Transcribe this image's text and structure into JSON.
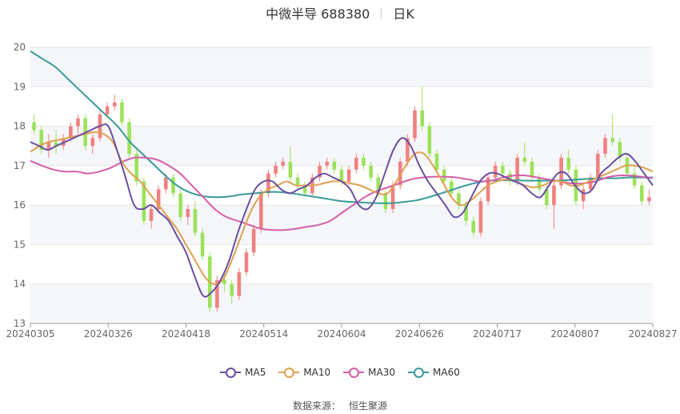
{
  "header": {
    "title": "中微半导 688380",
    "period": "日K"
  },
  "source": {
    "label": "数据来源：",
    "name": "恒生聚源"
  },
  "colors": {
    "up": "#f08080",
    "down": "#9be25a",
    "MA5": "#6a4fa0",
    "MA10": "#e0a050",
    "MA30": "#d55ea8",
    "MA60": "#3a9a98"
  },
  "chart_data": {
    "type": "candlestick",
    "title": "中微半导 688380",
    "ylim": [
      13,
      20
    ],
    "yticks": [
      13,
      14,
      15,
      16,
      17,
      18,
      19,
      20
    ],
    "xtick_labels": [
      "20240305",
      "20240326",
      "20240418",
      "20240514",
      "20240604",
      "20240626",
      "20240717",
      "20240807",
      "20240827"
    ],
    "grid": true,
    "legend_position": "bottom",
    "series_names": [
      "MA5",
      "MA10",
      "MA30",
      "MA60"
    ],
    "ohlc": [
      [
        18.1,
        18.3,
        17.8,
        17.9
      ],
      [
        17.9,
        18.0,
        17.3,
        17.4
      ],
      [
        17.4,
        17.8,
        17.2,
        17.6
      ],
      [
        17.6,
        17.9,
        17.3,
        17.5
      ],
      [
        17.5,
        17.8,
        17.4,
        17.7
      ],
      [
        17.7,
        18.1,
        17.6,
        18.0
      ],
      [
        18.0,
        18.3,
        17.8,
        18.2
      ],
      [
        18.2,
        18.3,
        17.4,
        17.5
      ],
      [
        17.5,
        17.8,
        17.3,
        17.7
      ],
      [
        17.7,
        18.4,
        17.6,
        18.3
      ],
      [
        18.3,
        18.6,
        18.2,
        18.5
      ],
      [
        18.5,
        18.8,
        18.4,
        18.6
      ],
      [
        18.6,
        18.7,
        18.0,
        18.1
      ],
      [
        18.1,
        18.2,
        17.2,
        17.3
      ],
      [
        17.3,
        17.4,
        16.5,
        16.6
      ],
      [
        16.6,
        16.7,
        15.5,
        15.6
      ],
      [
        15.6,
        16.0,
        15.4,
        15.9
      ],
      [
        15.9,
        16.5,
        15.8,
        16.4
      ],
      [
        16.4,
        16.8,
        16.3,
        16.7
      ],
      [
        16.7,
        16.8,
        16.2,
        16.3
      ],
      [
        16.3,
        16.4,
        15.6,
        15.7
      ],
      [
        15.7,
        16.0,
        15.5,
        15.9
      ],
      [
        15.9,
        16.1,
        15.2,
        15.3
      ],
      [
        15.3,
        15.4,
        14.6,
        14.7
      ],
      [
        14.7,
        14.8,
        13.3,
        13.4
      ],
      [
        13.4,
        14.2,
        13.3,
        14.1
      ],
      [
        14.1,
        14.3,
        13.8,
        14.0
      ],
      [
        14.0,
        14.1,
        13.5,
        13.7
      ],
      [
        13.7,
        14.4,
        13.6,
        14.3
      ],
      [
        14.3,
        14.9,
        14.2,
        14.8
      ],
      [
        14.8,
        15.5,
        14.7,
        15.4
      ],
      [
        15.4,
        16.4,
        15.3,
        16.3
      ],
      [
        16.3,
        16.9,
        16.2,
        16.8
      ],
      [
        16.8,
        17.1,
        16.7,
        17.0
      ],
      [
        17.0,
        17.2,
        16.9,
        17.1
      ],
      [
        17.1,
        17.5,
        16.6,
        16.7
      ],
      [
        16.7,
        16.8,
        16.4,
        16.5
      ],
      [
        16.5,
        16.6,
        16.2,
        16.3
      ],
      [
        16.3,
        16.8,
        16.2,
        16.7
      ],
      [
        16.7,
        17.1,
        16.6,
        17.0
      ],
      [
        17.0,
        17.2,
        16.9,
        17.1
      ],
      [
        17.1,
        17.2,
        16.8,
        16.9
      ],
      [
        16.9,
        17.0,
        16.5,
        16.6
      ],
      [
        16.6,
        17.0,
        16.5,
        16.9
      ],
      [
        16.9,
        17.3,
        16.8,
        17.2
      ],
      [
        17.2,
        17.3,
        16.9,
        17.0
      ],
      [
        17.0,
        17.1,
        16.6,
        16.7
      ],
      [
        16.7,
        16.8,
        16.2,
        16.3
      ],
      [
        16.3,
        16.4,
        15.8,
        15.9
      ],
      [
        15.9,
        16.6,
        15.8,
        16.5
      ],
      [
        16.5,
        17.2,
        16.4,
        17.1
      ],
      [
        17.1,
        17.8,
        17.0,
        17.7
      ],
      [
        17.7,
        18.5,
        17.6,
        18.4
      ],
      [
        18.4,
        19.0,
        17.9,
        18.0
      ],
      [
        18.0,
        18.1,
        17.2,
        17.3
      ],
      [
        17.3,
        17.4,
        16.8,
        16.9
      ],
      [
        16.9,
        17.0,
        16.5,
        16.6
      ],
      [
        16.6,
        16.7,
        16.2,
        16.3
      ],
      [
        16.3,
        16.4,
        15.9,
        16.0
      ],
      [
        16.0,
        16.1,
        15.5,
        15.6
      ],
      [
        15.6,
        15.7,
        15.2,
        15.3
      ],
      [
        15.3,
        16.2,
        15.2,
        16.1
      ],
      [
        16.1,
        16.8,
        16.0,
        16.7
      ],
      [
        16.7,
        17.1,
        16.6,
        17.0
      ],
      [
        17.0,
        17.1,
        16.7,
        16.8
      ],
      [
        16.8,
        16.9,
        16.5,
        16.6
      ],
      [
        16.6,
        17.3,
        16.5,
        17.2
      ],
      [
        17.2,
        17.6,
        17.0,
        17.1
      ],
      [
        17.1,
        17.2,
        16.6,
        16.7
      ],
      [
        16.7,
        16.8,
        16.3,
        16.4
      ],
      [
        16.4,
        16.5,
        15.9,
        16.0
      ],
      [
        16.0,
        16.6,
        15.4,
        16.5
      ],
      [
        16.5,
        17.3,
        16.4,
        17.2
      ],
      [
        17.2,
        17.4,
        16.8,
        16.9
      ],
      [
        16.9,
        17.0,
        16.0,
        16.1
      ],
      [
        16.1,
        16.5,
        15.9,
        16.4
      ],
      [
        16.4,
        16.8,
        16.3,
        16.7
      ],
      [
        16.7,
        17.4,
        16.6,
        17.3
      ],
      [
        17.3,
        17.8,
        17.2,
        17.7
      ],
      [
        17.7,
        18.3,
        17.5,
        17.6
      ],
      [
        17.6,
        17.7,
        17.1,
        17.2
      ],
      [
        17.2,
        17.3,
        16.7,
        16.8
      ],
      [
        16.8,
        17.0,
        16.4,
        16.5
      ],
      [
        16.5,
        16.6,
        16.0,
        16.1
      ],
      [
        16.1,
        16.4,
        16.0,
        16.2
      ]
    ],
    "ma": {
      "MA5": [
        17.6,
        17.5,
        17.4,
        17.5,
        17.6,
        17.7,
        17.8,
        17.9,
        18.0,
        18.0,
        17.4,
        16.7,
        16.0,
        15.9,
        16.0,
        15.8,
        15.6,
        15.2,
        14.8,
        14.2,
        13.7,
        13.8,
        14.1,
        14.6,
        15.3,
        15.9,
        16.4,
        16.6,
        16.6,
        16.4,
        16.3,
        16.4,
        16.5,
        16.7,
        16.8,
        16.7,
        16.6,
        16.4,
        16.0,
        15.9,
        16.2,
        16.8,
        17.4,
        17.7,
        17.5,
        17.0,
        16.6,
        16.3,
        16.0,
        15.7,
        15.8,
        16.2,
        16.6,
        16.8,
        16.8,
        16.7,
        16.6,
        16.5,
        16.3,
        16.2,
        16.5,
        16.8,
        16.8,
        16.5,
        16.3,
        16.4,
        16.8,
        17.0,
        17.2,
        17.3,
        17.1,
        16.8,
        16.5
      ],
      "MA10": [
        17.35,
        17.5,
        17.6,
        17.65,
        17.7,
        17.75,
        17.8,
        17.85,
        17.8,
        17.6,
        17.1,
        16.8,
        16.6,
        16.3,
        16.0,
        15.7,
        15.4,
        15.0,
        14.6,
        14.2,
        14.0,
        14.1,
        14.6,
        15.2,
        15.8,
        16.2,
        16.4,
        16.5,
        16.6,
        16.5,
        16.5,
        16.5,
        16.55,
        16.6,
        16.6,
        16.55,
        16.5,
        16.4,
        16.3,
        16.3,
        16.6,
        17.0,
        17.3,
        17.3,
        17.0,
        16.6,
        16.2,
        16.0,
        16.1,
        16.3,
        16.5,
        16.6,
        16.65,
        16.6,
        16.5,
        16.45,
        16.5,
        16.6,
        16.6,
        16.5,
        16.5,
        16.6,
        16.7,
        16.8,
        16.9,
        17.0,
        17.0,
        16.95,
        16.85
      ],
      "MA30": [
        17.12,
        17.0,
        16.9,
        16.85,
        16.85,
        16.8,
        16.85,
        16.95,
        17.1,
        17.2,
        17.2,
        17.15,
        17.0,
        16.8,
        16.5,
        16.2,
        15.9,
        15.7,
        15.6,
        15.5,
        15.4,
        15.37,
        15.37,
        15.4,
        15.45,
        15.5,
        15.6,
        15.8,
        16.0,
        16.2,
        16.35,
        16.45,
        16.55,
        16.65,
        16.7,
        16.72,
        16.72,
        16.7,
        16.65,
        16.6,
        16.62,
        16.7,
        16.75,
        16.75,
        16.7,
        16.65,
        16.6,
        16.55,
        16.55,
        16.6,
        16.7,
        16.75,
        16.75,
        16.72,
        16.68
      ],
      "MA60": [
        19.9,
        19.7,
        19.5,
        19.2,
        18.9,
        18.6,
        18.3,
        18.0,
        17.6,
        17.3,
        17.0,
        16.7,
        16.45,
        16.3,
        16.22,
        16.2,
        16.22,
        16.27,
        16.3,
        16.33,
        16.33,
        16.3,
        16.25,
        16.2,
        16.15,
        16.1,
        16.08,
        16.06,
        16.05,
        16.05,
        16.08,
        16.12,
        16.2,
        16.3,
        16.4,
        16.5,
        16.58,
        16.62,
        16.63,
        16.63,
        16.62,
        16.62,
        16.62,
        16.63,
        16.65,
        16.67,
        16.68,
        16.68,
        16.7,
        16.7,
        16.7
      ]
    }
  }
}
